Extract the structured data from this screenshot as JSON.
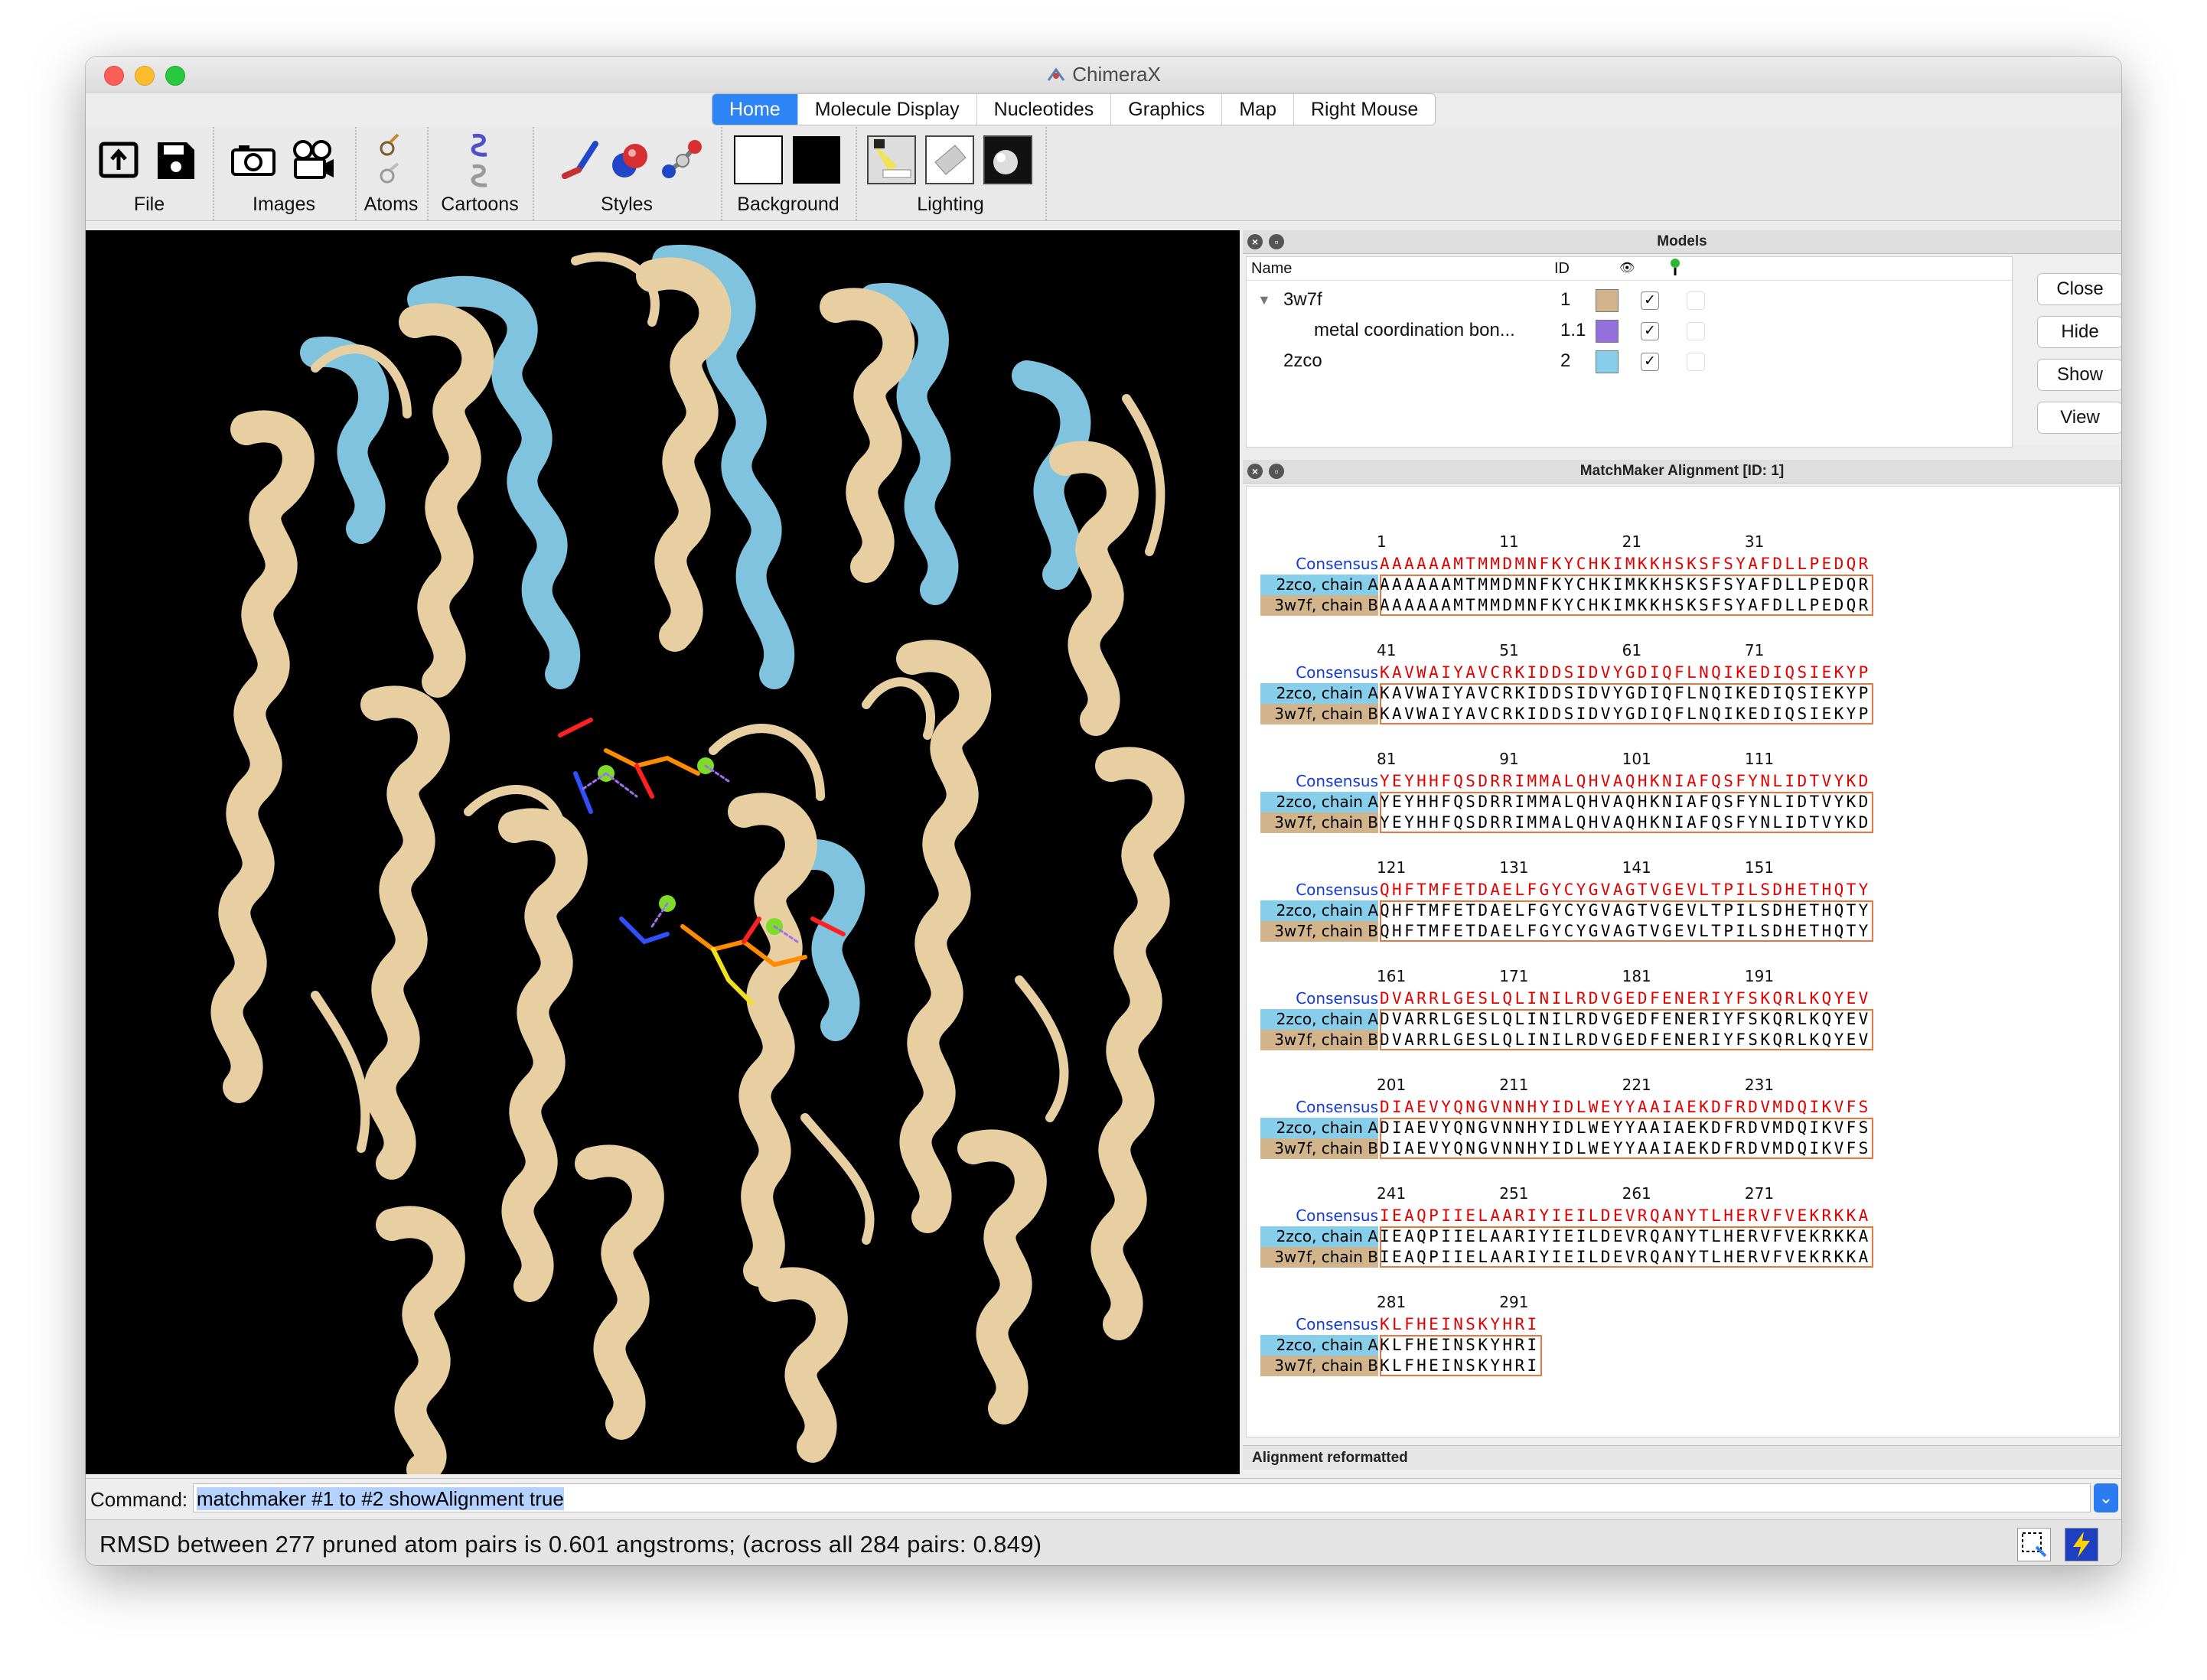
{
  "window": {
    "title": "ChimeraX"
  },
  "tabs": [
    {
      "label": "Home",
      "active": true
    },
    {
      "label": "Molecule Display",
      "active": false
    },
    {
      "label": "Nucleotides",
      "active": false
    },
    {
      "label": "Graphics",
      "active": false
    },
    {
      "label": "Map",
      "active": false
    },
    {
      "label": "Right Mouse",
      "active": false
    }
  ],
  "toolbar": {
    "groups": [
      {
        "label": "File",
        "icons": [
          "open-icon",
          "save-icon"
        ]
      },
      {
        "label": "Images",
        "icons": [
          "camera-icon",
          "movie-camera-icon"
        ]
      },
      {
        "label": "Atoms",
        "icons": [
          "atoms-show-icon",
          "atoms-hide-icon"
        ]
      },
      {
        "label": "Cartoons",
        "icons": [
          "cartoon-show-icon",
          "cartoon-hide-icon"
        ]
      },
      {
        "label": "Styles",
        "icons": [
          "stick-style-icon",
          "sphere-style-icon",
          "ball-stick-style-icon"
        ]
      },
      {
        "label": "Background",
        "icons": [
          "white-background-icon",
          "black-background-icon"
        ]
      },
      {
        "label": "Lighting",
        "icons": [
          "simple-lighting-icon",
          "soft-lighting-icon",
          "full-lighting-icon"
        ]
      }
    ]
  },
  "models_panel": {
    "title": "Models",
    "columns": {
      "name": "Name",
      "id": "ID"
    },
    "rows": [
      {
        "name": "3w7f",
        "id": "1",
        "color": "#d2b48c",
        "shown": true,
        "expanded": true
      },
      {
        "name": "metal coordination bon...",
        "id": "1.1",
        "color": "#9370db",
        "shown": true
      },
      {
        "name": "2zco",
        "id": "2",
        "color": "#87ceeb",
        "shown": true
      }
    ],
    "buttons": {
      "close": "Close",
      "hide": "Hide",
      "show": "Show",
      "view": "View"
    }
  },
  "alignment_panel": {
    "title": "MatchMaker Alignment [ID: 1]",
    "labels": {
      "consensus": "Consensus",
      "a": "2zco, chain A",
      "b": "3w7f, chain B"
    },
    "blocks": [
      {
        "nums": [
          "1",
          "11",
          "21",
          "31"
        ],
        "seq": "AAAAAAMTMMDMNFKYCHKIMKKHSKSFSYAFDLLPEDQR"
      },
      {
        "nums": [
          "41",
          "51",
          "61",
          "71"
        ],
        "seq": "KAVWAIYAVCRKIDDSIDVYGDIQFLNQIKEDIQSIEKYP"
      },
      {
        "nums": [
          "81",
          "91",
          "101",
          "111"
        ],
        "seq": "YEYHHFQSDRRIMMALQHVAQHKNIAFQSFYNLIDTVYKD"
      },
      {
        "nums": [
          "121",
          "131",
          "141",
          "151"
        ],
        "seq": "QHFTMFETDAELFGYCYGVAGTVGEVLTPILSDHETHQTY"
      },
      {
        "nums": [
          "161",
          "171",
          "181",
          "191"
        ],
        "seq": "DVARRLGESLQLINILRDVGEDFENERIYFSKQRLKQYEV"
      },
      {
        "nums": [
          "201",
          "211",
          "221",
          "231"
        ],
        "seq": "DIAEVYQNGVNNHYIDLWEYYAAIAEKDFRDVMDQIKVFS"
      },
      {
        "nums": [
          "241",
          "251",
          "261",
          "271"
        ],
        "seq": "IEAQPIIELAARIYIEILDEVRQANYTLHERVFVEKRKKA"
      },
      {
        "nums": [
          "281",
          "291"
        ],
        "seq": "KLFHEINSKYHRI"
      }
    ],
    "status": "Alignment reformatted"
  },
  "command": {
    "label": "Command:",
    "value": "matchmaker #1 to #2 showAlignment true"
  },
  "status": {
    "text": "RMSD between 277 pruned atom pairs is 0.601 angstroms; (across all 284 pairs: 0.849)"
  },
  "colors": {
    "tan_model": "#d2b48c",
    "blue_model": "#87ceeb",
    "consensus": "#e00000",
    "consensus_label": "#1238d8",
    "accent": "#2c84f6"
  }
}
